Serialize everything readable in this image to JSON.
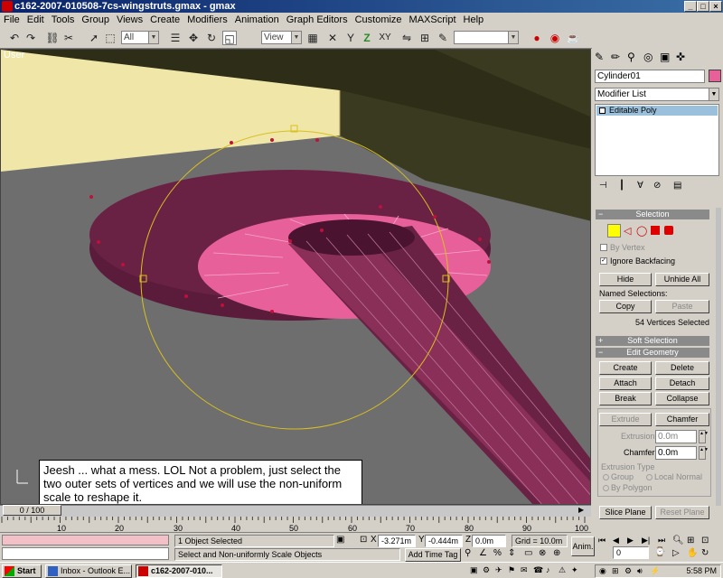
{
  "window": {
    "title": "c162-2007-010508-7cs-wingstruts.gmax - gmax",
    "min": "_",
    "max": "□",
    "close": "×"
  },
  "menu": [
    "File",
    "Edit",
    "Tools",
    "Group",
    "Views",
    "Create",
    "Modifiers",
    "Animation",
    "Graph Editors",
    "Customize",
    "MAXScript",
    "Help"
  ],
  "toolbar": {
    "filter_select": "All",
    "coord_select": "View",
    "named_sel": ""
  },
  "viewport": {
    "label": "User"
  },
  "callout": {
    "text": "Jeesh ... what a mess. LOL  Not a problem, just select the two outer sets of vertices and we will use the non-uniform scale to reshape it."
  },
  "command_panel": {
    "object_name": "Cylinder01",
    "modifier_list": "Modifier List",
    "stack_item": "Editable Poly",
    "selection": {
      "header": "Selection",
      "by_vertex": "By Vertex",
      "ignore_backfacing": "Ignore Backfacing",
      "hide": "Hide",
      "unhide_all": "Unhide All",
      "named_selections": "Named Selections:",
      "copy": "Copy",
      "paste": "Paste",
      "count": "54 Vertices Selected"
    },
    "soft_selection": "Soft Selection",
    "edit_geometry": {
      "header": "Edit Geometry",
      "create": "Create",
      "delete": "Delete",
      "attach": "Attach",
      "detach": "Detach",
      "break": "Break",
      "collapse": "Collapse",
      "extrude": "Extrude",
      "chamfer": "Chamfer",
      "extrusion_label": "Extrusion",
      "extrusion_value": "0.0m",
      "chamfer_label": "Chamfer",
      "chamfer_value": "0.0m",
      "extrusion_type": "Extrusion Type",
      "group": "Group",
      "local_normal": "Local Normal",
      "by_polygon": "By Polygon",
      "slice_plane": "Slice Plane",
      "reset_plane": "Reset Plane"
    }
  },
  "timeline": {
    "frame": "0 / 100",
    "ticks": [
      "10",
      "20",
      "30",
      "40",
      "50",
      "60",
      "70",
      "80",
      "90",
      "100"
    ]
  },
  "status": {
    "selected": "1 Object Selected",
    "prompt": "Select and Non-uniformly Scale Objects",
    "x_label": "X",
    "x": "-3.271m",
    "y_label": "Y",
    "y": "-0.444m",
    "z_label": "Z",
    "z": "0.0m",
    "grid": "Grid = 10.0m",
    "add_time_tag": "Add Time Tag",
    "anim": "Anim.",
    "frame_field": "0"
  },
  "taskbar": {
    "start": "Start",
    "tasks": [
      "Inbox - Outlook E...",
      "c162-2007-010..."
    ],
    "clock": "5:58 PM"
  }
}
